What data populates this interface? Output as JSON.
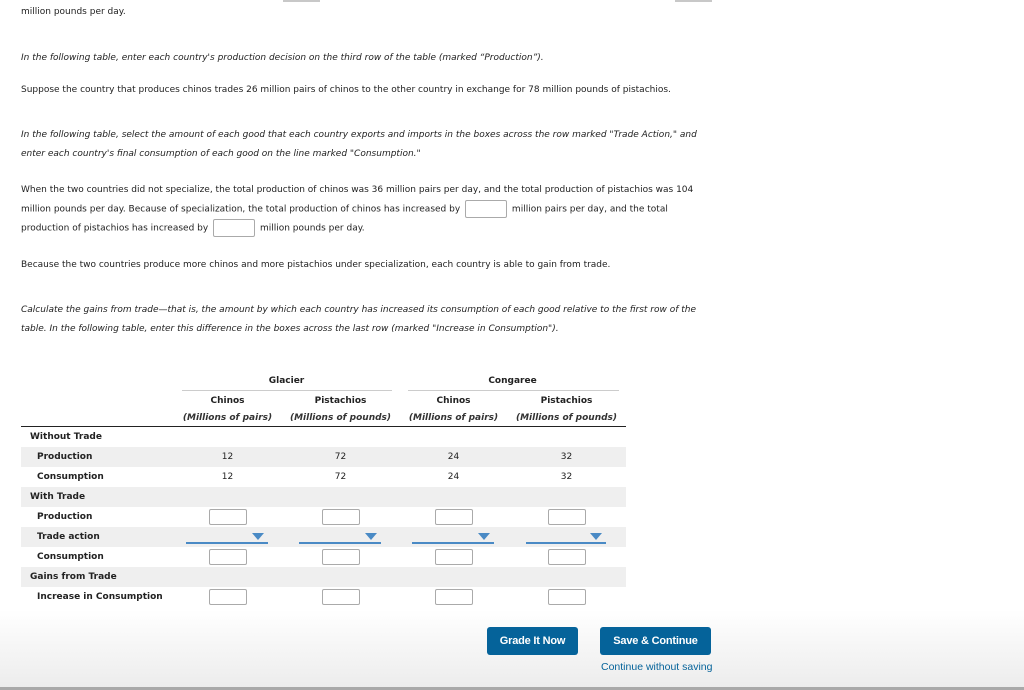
{
  "intro": {
    "line0": "million pounds per day.",
    "instruction_production": "In the following table, enter each country's production decision on the third row of the table (marked “Production”).",
    "trade_assumption": "Suppose the country that produces chinos trades 26 million pairs of chinos to the other country in exchange for 78 million pounds of pistachios.",
    "instruction_trade_1": "In the following table, select the amount of each good that each country exports and imports in the boxes across the row marked \"Trade Action,\" and",
    "instruction_trade_2": "enter each country's final consumption of each good on the line marked \"Consumption.\""
  },
  "specialization": {
    "line1": "When the two countries did not specialize, the total production of chinos was 36 million pairs per day, and the total production of pistachios was 104",
    "line2_before": "million pounds per day. Because of specialization, the total production of chinos has increased by",
    "line2_after": "million pairs per day, and the total",
    "line3_before": "production of pistachios has increased by",
    "line3_after": "million pounds per day.",
    "chinos_increase_value": "",
    "pistachios_increase_value": ""
  },
  "gain_statement": "Because the two countries produce more chinos and more pistachios under specialization, each country is able to gain from trade.",
  "gains_instruction_1": "Calculate the gains from trade—that is, the amount by which each country has increased its consumption of each good relative to the first row of the",
  "gains_instruction_2": "table. In the following table, enter this difference in the boxes across the last row (marked \"Increase in Consumption\").",
  "table": {
    "countries": [
      "Glacier",
      "Congaree"
    ],
    "goods": [
      {
        "name": "Chinos",
        "unit": "(Millions of pairs)"
      },
      {
        "name": "Pistachios",
        "unit": "(Millions of pounds)"
      },
      {
        "name": "Chinos",
        "unit": "(Millions of pairs)"
      },
      {
        "name": "Pistachios",
        "unit": "(Millions of pounds)"
      }
    ],
    "rows": {
      "without_trade": "Without Trade",
      "production": {
        "label": "Production",
        "values": [
          "12",
          "72",
          "24",
          "32"
        ]
      },
      "consumption": {
        "label": "Consumption",
        "values": [
          "12",
          "72",
          "24",
          "32"
        ]
      },
      "with_trade": "With Trade",
      "wt_production": {
        "label": "Production",
        "values": [
          "",
          "",
          "",
          ""
        ]
      },
      "trade_action": {
        "label": "Trade action",
        "selected": [
          "",
          "",
          "",
          ""
        ]
      },
      "wt_consumption": {
        "label": "Consumption",
        "values": [
          "",
          "",
          "",
          ""
        ]
      },
      "gains": "Gains from Trade",
      "increase": {
        "label": "Increase in Consumption",
        "values": [
          "",
          "",
          "",
          ""
        ]
      }
    }
  },
  "footer": {
    "grade_button": "Grade It Now",
    "save_button": "Save & Continue",
    "continue_link": "Continue without saving"
  },
  "colors": {
    "button": "#05639a",
    "dropdown_accent": "#4a8ac5",
    "row_shade": "#efefef"
  }
}
